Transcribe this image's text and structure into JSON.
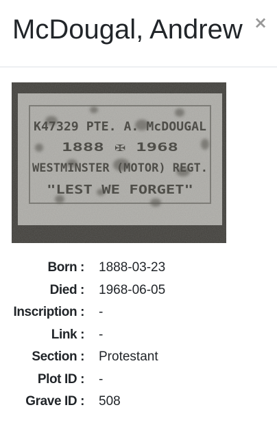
{
  "modal": {
    "title": "McDougal, Andrew",
    "close_label": "×"
  },
  "photo": {
    "description": "grave marker photo",
    "inscription_lines": [
      "K47329 PTE. A. McDOUGAL",
      "1888 ✠ 1968",
      "WESTMINSTER (MOTOR) REGT.",
      "\"LEST WE FORGET\""
    ]
  },
  "details": [
    {
      "label": "Born :",
      "value": "1888-03-23"
    },
    {
      "label": "Died :",
      "value": "1968-06-05"
    },
    {
      "label": "Inscription :",
      "value": "-"
    },
    {
      "label": "Link :",
      "value": "-"
    },
    {
      "label": "Section :",
      "value": "Protestant"
    },
    {
      "label": "Plot ID :",
      "value": "-"
    },
    {
      "label": "Grave ID :",
      "value": "508"
    }
  ],
  "colors": {
    "text": "#212529",
    "close": "#999999",
    "divider": "#dee2e6"
  }
}
